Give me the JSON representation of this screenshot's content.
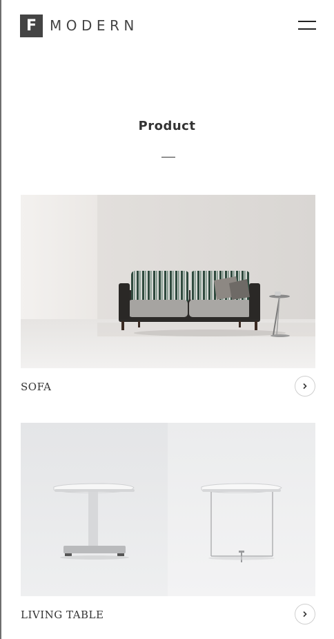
{
  "header": {
    "logo_letter": "F",
    "logo_word": "MODERN",
    "menu_icon": "hamburger-icon"
  },
  "page": {
    "title": "Product"
  },
  "products": [
    {
      "label": "SOFA",
      "image": "sofa-photo",
      "arrow_icon": "chevron-right-icon"
    },
    {
      "label": "LIVING TABLE",
      "image": "living-table-photo",
      "arrow_icon": "chevron-right-icon"
    }
  ],
  "colors": {
    "logo_box": "#444444",
    "text": "#333333",
    "accent_line": "#333333",
    "button_border": "#cfcfcf"
  }
}
